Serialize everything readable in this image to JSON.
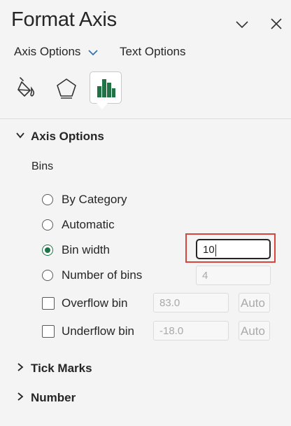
{
  "header": {
    "title": "Format Axis",
    "collapse_icon": "chevron-down-icon",
    "close_icon": "close-icon"
  },
  "tabs": {
    "axis_options": "Axis Options",
    "text_options": "Text Options"
  },
  "icon_tabs": [
    "fill-line-icon",
    "effects-pentagon-icon",
    "axis-options-bar-chart-icon"
  ],
  "axis_options_section": {
    "heading": "Axis Options",
    "bins_label": "Bins",
    "by_category": "By Category",
    "automatic": "Automatic",
    "bin_width": {
      "label": "Bin width",
      "value": "10",
      "selected": true
    },
    "number_of_bins": {
      "label": "Number of bins",
      "value": "4"
    },
    "overflow": {
      "label": "Overflow bin",
      "value": "83.0",
      "auto_label": "Auto"
    },
    "underflow": {
      "label": "Underflow bin",
      "value": "-18.0",
      "auto_label": "Auto"
    }
  },
  "sections": {
    "tick_marks": "Tick Marks",
    "number": "Number"
  },
  "colors": {
    "accent_green": "#217346",
    "highlight_red": "#d9453d"
  }
}
